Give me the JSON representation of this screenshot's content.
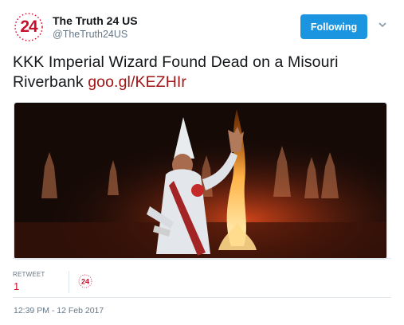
{
  "account": {
    "avatar_text": "24",
    "display_name": "The Truth 24 US",
    "handle": "@TheTruth24US"
  },
  "follow_button": {
    "label": "Following"
  },
  "tweet": {
    "text": "KKK Imperial Wizard Found Dead on a Misouri Riverbank ",
    "link": "goo.gl/KEZHIr"
  },
  "stats": {
    "retweet_label": "RETWEET",
    "retweet_count": "1",
    "retweeter_avatar_text": "24"
  },
  "timestamp": "12:39 PM - 12 Feb 2017",
  "colors": {
    "brand_red": "#c8102e",
    "follow_blue": "#1b95e0",
    "link_red": "#a31515"
  },
  "icons": {
    "caret": "chevron-down-icon"
  }
}
